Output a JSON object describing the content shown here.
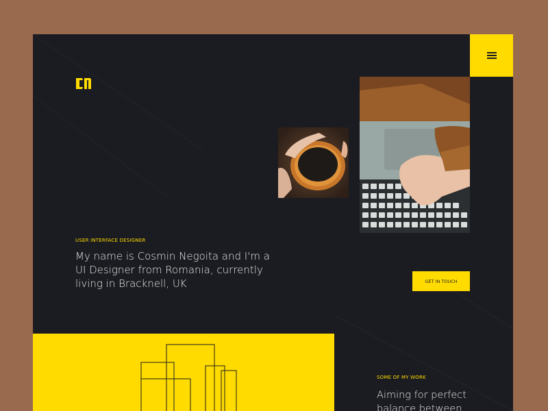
{
  "colors": {
    "backdrop": "#9a6a4f",
    "page_bg": "#1b1c21",
    "accent": "#ffdb00",
    "text": "#e8e8e8"
  },
  "header": {
    "logo": "CN",
    "menu_icon": "hamburger-icon"
  },
  "hero": {
    "eyebrow": "USER INTERFACE DESIGNER",
    "intro": "My name is Cosmin Negoita and I'm a UI Designer from Romania, currently living in Bracknell, UK",
    "cta_label": "GET IN TOUCH",
    "images": [
      "coffee-cup-photo",
      "laptop-typing-photo"
    ]
  },
  "work": {
    "eyebrow": "SOME OF MY WORK",
    "heading": "Aiming for perfect balance between"
  }
}
